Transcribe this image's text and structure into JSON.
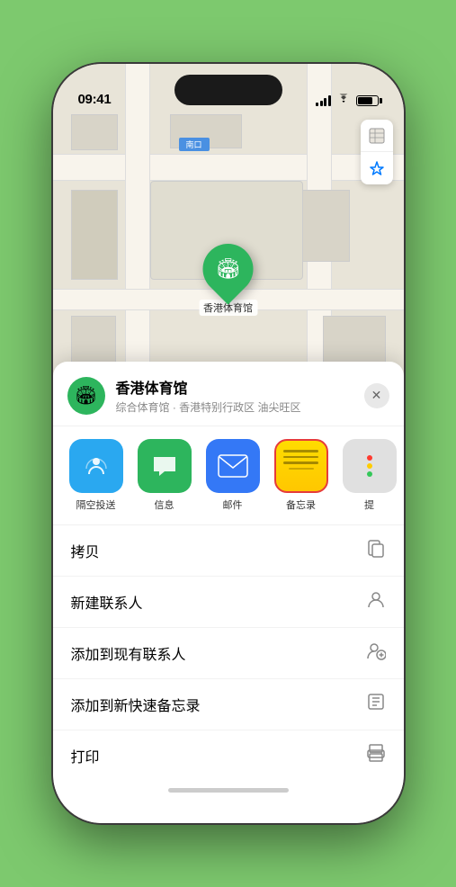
{
  "status_bar": {
    "time": "09:41",
    "location_arrow": "▲"
  },
  "map": {
    "label_text": "南口",
    "venue_name_pin": "香港体育馆",
    "map_label": "南口"
  },
  "place": {
    "name": "香港体育馆",
    "description": "综合体育馆 · 香港特别行政区 油尖旺区",
    "icon_emoji": "🏟"
  },
  "share_actions": [
    {
      "id": "airdrop",
      "label": "隔空投送",
      "type": "airdrop"
    },
    {
      "id": "messages",
      "label": "信息",
      "type": "messages"
    },
    {
      "id": "mail",
      "label": "邮件",
      "type": "mail"
    },
    {
      "id": "notes",
      "label": "备忘录",
      "type": "notes"
    },
    {
      "id": "more",
      "label": "提",
      "type": "more"
    }
  ],
  "actions": [
    {
      "id": "copy",
      "label": "拷贝",
      "icon": "copy"
    },
    {
      "id": "new-contact",
      "label": "新建联系人",
      "icon": "person"
    },
    {
      "id": "add-existing",
      "label": "添加到现有联系人",
      "icon": "person-add"
    },
    {
      "id": "add-notes",
      "label": "添加到新快速备忘录",
      "icon": "notes-add"
    },
    {
      "id": "print",
      "label": "打印",
      "icon": "print"
    }
  ],
  "buttons": {
    "close": "✕"
  }
}
